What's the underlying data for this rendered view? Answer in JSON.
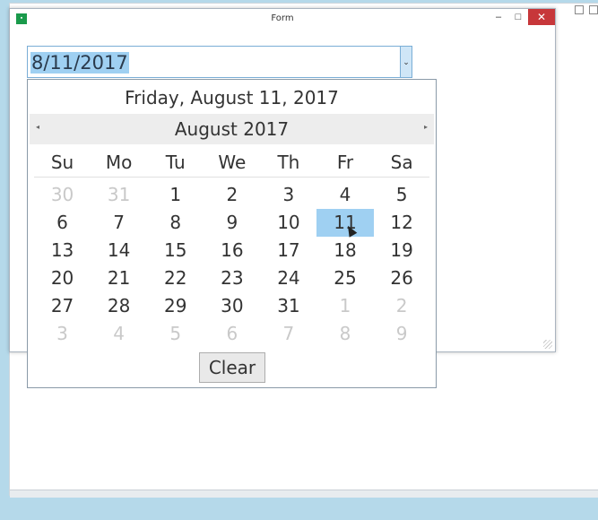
{
  "window": {
    "title": "Form",
    "icon": "app-icon",
    "minimize_glyph": "–",
    "maximize_glyph": "□",
    "close_glyph": "✕"
  },
  "date_picker": {
    "value": "8/11/2017",
    "dropdown_glyph": "⌄"
  },
  "calendar": {
    "long_date": "Friday, August 11, 2017",
    "month_label": "August 2017",
    "prev_glyph": "◂",
    "next_glyph": "▸",
    "day_headers": [
      "Su",
      "Mo",
      "Tu",
      "We",
      "Th",
      "Fr",
      "Sa"
    ],
    "weeks": [
      [
        {
          "d": "30",
          "other": true
        },
        {
          "d": "31",
          "other": true
        },
        {
          "d": "1"
        },
        {
          "d": "2"
        },
        {
          "d": "3"
        },
        {
          "d": "4"
        },
        {
          "d": "5"
        }
      ],
      [
        {
          "d": "6"
        },
        {
          "d": "7"
        },
        {
          "d": "8"
        },
        {
          "d": "9"
        },
        {
          "d": "10"
        },
        {
          "d": "11",
          "selected": true
        },
        {
          "d": "12"
        }
      ],
      [
        {
          "d": "13"
        },
        {
          "d": "14"
        },
        {
          "d": "15"
        },
        {
          "d": "16"
        },
        {
          "d": "17"
        },
        {
          "d": "18"
        },
        {
          "d": "19"
        }
      ],
      [
        {
          "d": "20"
        },
        {
          "d": "21"
        },
        {
          "d": "22"
        },
        {
          "d": "23"
        },
        {
          "d": "24"
        },
        {
          "d": "25"
        },
        {
          "d": "26"
        }
      ],
      [
        {
          "d": "27"
        },
        {
          "d": "28"
        },
        {
          "d": "29"
        },
        {
          "d": "30"
        },
        {
          "d": "31"
        },
        {
          "d": "1",
          "other": true
        },
        {
          "d": "2",
          "other": true
        }
      ],
      [
        {
          "d": "3",
          "other": true
        },
        {
          "d": "4",
          "other": true
        },
        {
          "d": "5",
          "other": true
        },
        {
          "d": "6",
          "other": true
        },
        {
          "d": "7",
          "other": true
        },
        {
          "d": "8",
          "other": true
        },
        {
          "d": "9",
          "other": true
        }
      ]
    ],
    "clear_label": "Clear"
  },
  "colors": {
    "selection": "#9fd0f2",
    "close_button": "#c7373a",
    "desktop": "#b5d9ea"
  }
}
